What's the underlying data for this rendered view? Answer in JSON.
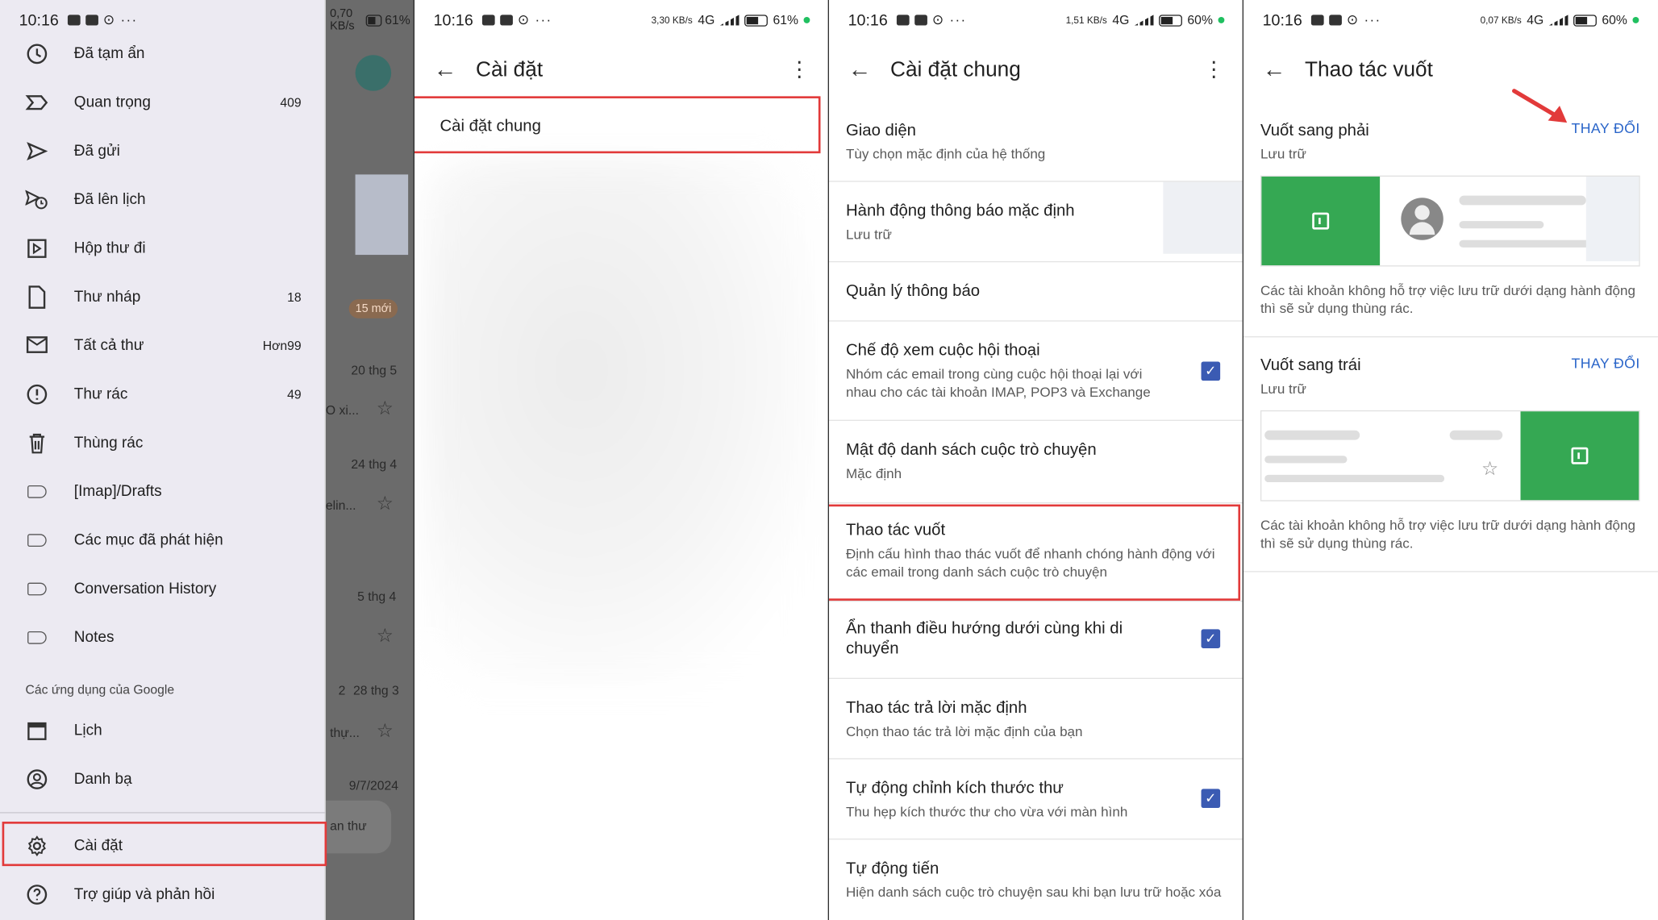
{
  "status": {
    "p1": {
      "time": "10:16",
      "speed": "0,70 KB/s",
      "battery": "61%"
    },
    "p2": {
      "time": "10:16",
      "speed": "3,30 KB/s",
      "battery": "61%"
    },
    "p3": {
      "time": "10:16",
      "speed": "1,51 KB/s",
      "battery": "60%"
    },
    "p4": {
      "time": "10:16",
      "speed": "0,07 KB/s",
      "battery": "60%"
    },
    "signal": "4G"
  },
  "drawer": {
    "items": [
      {
        "label": "Đã tạm ẩn",
        "count": "",
        "icon": "snooze-icon"
      },
      {
        "label": "Quan trọng",
        "count": "409",
        "icon": "important-icon"
      },
      {
        "label": "Đã gửi",
        "count": "",
        "icon": "send-icon"
      },
      {
        "label": "Đã lên lịch",
        "count": "",
        "icon": "scheduled-icon"
      },
      {
        "label": "Hộp thư đi",
        "count": "",
        "icon": "outbox-icon"
      },
      {
        "label": "Thư nháp",
        "count": "18",
        "icon": "draft-icon"
      },
      {
        "label": "Tất cả thư",
        "count": "Hơn99",
        "icon": "all-mail-icon"
      },
      {
        "label": "Thư rác",
        "count": "49",
        "icon": "spam-icon"
      },
      {
        "label": "Thùng rác",
        "count": "",
        "icon": "trash-icon"
      },
      {
        "label": "[Imap]/Drafts",
        "count": "",
        "icon": "label-icon"
      },
      {
        "label": "Các mục đã phát hiện",
        "count": "",
        "icon": "label-icon"
      },
      {
        "label": "Conversation History",
        "count": "",
        "icon": "label-icon"
      },
      {
        "label": "Notes",
        "count": "",
        "icon": "label-icon"
      }
    ],
    "google_apps_header": "Các ứng dụng của Google",
    "apps": [
      {
        "label": "Lịch",
        "icon": "calendar-icon"
      },
      {
        "label": "Danh bạ",
        "icon": "contacts-icon"
      }
    ],
    "settings": "Cài đặt",
    "help": "Trợ giúp và phản hồi"
  },
  "behind": {
    "new_badge": "15 mới",
    "dates": [
      "20 thg 5",
      "24 thg 4",
      "5 thg 4",
      "28 thg 3",
      "9/7/2024"
    ],
    "count_prefix": "2",
    "snippets": [
      "...",
      "O xi...",
      "elin...",
      "thự...",
      "an thư"
    ]
  },
  "settings_screen": {
    "title": "Cài đặt",
    "general": "Cài đặt chung"
  },
  "general_screen": {
    "title": "Cài đặt chung",
    "items": [
      {
        "title": "Giao diện",
        "subtitle": "Tùy chọn mặc định của hệ thống"
      },
      {
        "title": "Hành động thông báo mặc định",
        "subtitle": "Lưu trữ"
      },
      {
        "title": "Quản lý thông báo",
        "subtitle": ""
      },
      {
        "title": "Chế độ xem cuộc hội thoại",
        "subtitle": "Nhóm các email trong cùng cuộc hội thoại lại với nhau cho các tài khoản IMAP, POP3 và Exchange",
        "checked": true
      },
      {
        "title": "Mật độ danh sách cuộc trò chuyện",
        "subtitle": "Mặc định"
      },
      {
        "title": "Thao tác vuốt",
        "subtitle": "Định cấu hình thao thác vuốt để nhanh chóng hành động với các email trong danh sách cuộc trò chuyện"
      },
      {
        "title": "Ẩn thanh điều hướng dưới cùng khi di chuyển",
        "subtitle": "",
        "checked": true
      },
      {
        "title": "Thao tác trả lời mặc định",
        "subtitle": "Chọn thao tác trả lời mặc định của bạn"
      },
      {
        "title": "Tự động chỉnh kích thước thư",
        "subtitle": "Thu hẹp kích thước thư cho vừa với màn hình",
        "checked": true
      },
      {
        "title": "Tự động tiến",
        "subtitle": "Hiện danh sách cuộc trò chuyện sau khi bạn lưu trữ hoặc xóa"
      }
    ]
  },
  "swipe_screen": {
    "title": "Thao tác vuốt",
    "right": {
      "title": "Vuốt sang phải",
      "action": "Lưu trữ",
      "change": "THAY ĐỔI"
    },
    "left": {
      "title": "Vuốt sang trái",
      "action": "Lưu trữ",
      "change": "THAY ĐỔI"
    },
    "note": "Các tài khoản không hỗ trợ việc lưu trữ dưới dạng hành động thì sẽ sử dụng thùng rác."
  },
  "colors": {
    "highlight": "#e23a3a",
    "link": "#2a65c9",
    "swipe_green": "#35a853",
    "checkbox": "#3b5bb3"
  }
}
